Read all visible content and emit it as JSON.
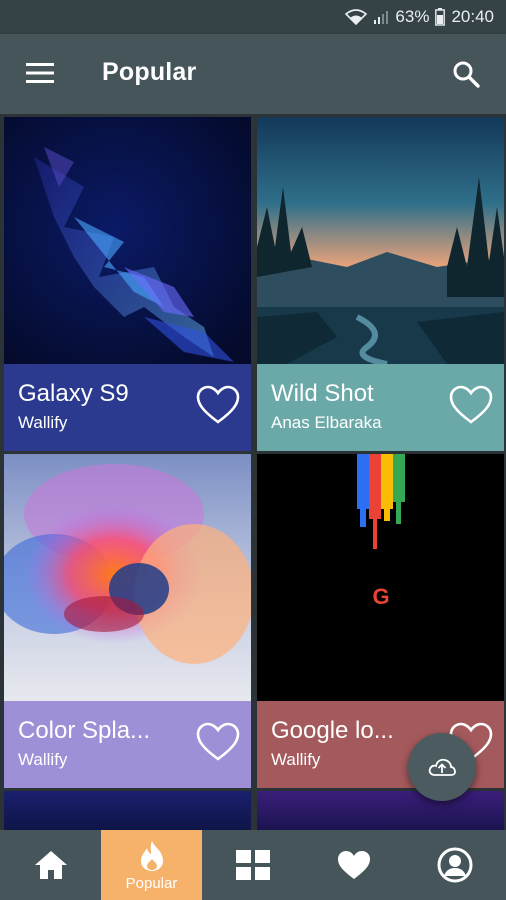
{
  "status": {
    "battery": "63%",
    "time": "20:40"
  },
  "appbar": {
    "title": "Popular"
  },
  "cards": [
    {
      "name": "Galaxy S9",
      "author": "Wallify",
      "color": "#2b3a8f"
    },
    {
      "name": "Wild Shot",
      "author": "Anas Elbaraka",
      "color": "#6aa9a7"
    },
    {
      "name": "Color Spla...",
      "author": "Wallify",
      "color": "#9f8fd6"
    },
    {
      "name": "Google lo...",
      "author": "Wallify",
      "color": "#a45a5d"
    }
  ],
  "nav": {
    "active_label": "Popular",
    "active_color": "#f6b26b"
  },
  "icons": [
    "menu-icon",
    "search-icon",
    "heart-icon",
    "cloud-upload-icon",
    "home-icon",
    "fire-icon",
    "grid-icon",
    "favorite-icon",
    "account-icon",
    "wifi-icon",
    "signal-icon",
    "battery-icon"
  ]
}
